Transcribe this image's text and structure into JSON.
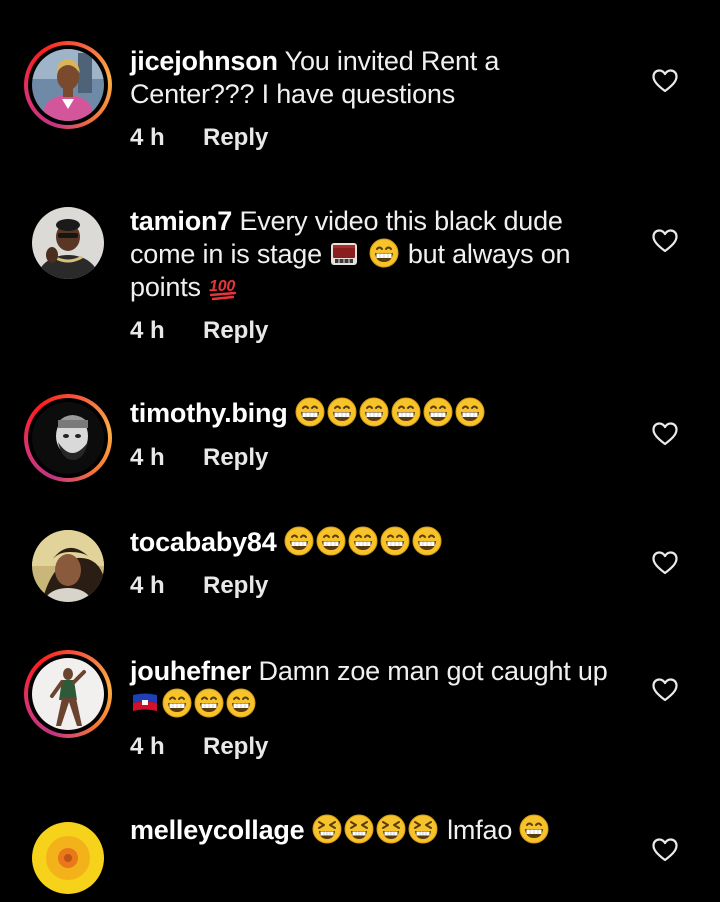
{
  "comments": [
    {
      "username": "jicejohnson",
      "text": "You invited Rent a Center??? I have questions",
      "time": "4 h",
      "reply": "Reply"
    },
    {
      "username": "tamion7",
      "text": "Every video this black dude come in is stage",
      "text_mid": "but always on points",
      "time": "4 h",
      "reply": "Reply"
    },
    {
      "username": "timothy.bing",
      "time": "4 h",
      "reply": "Reply"
    },
    {
      "username": "tocababy84",
      "time": "4 h",
      "reply": "Reply"
    },
    {
      "username": "jouhefner",
      "text": "Damn zoe man got caught up",
      "time": "4 h",
      "reply": "Reply"
    },
    {
      "username": "melleycollage",
      "text": "lmfao"
    }
  ],
  "icons": {
    "like": "heart-outline-icon",
    "grin": "grinning-face-emoji",
    "hundred": "hundred-points-emoji",
    "stage": "stage-emoji",
    "flag": "haiti-flag-emoji",
    "laugh": "squinting-laugh-emoji"
  },
  "colors": {
    "background": "#000000",
    "text": "#f5f5f5",
    "story_ring_start": "#c13584",
    "story_ring_end": "#fcaf45",
    "emoji_yellow": "#f7c32b"
  }
}
